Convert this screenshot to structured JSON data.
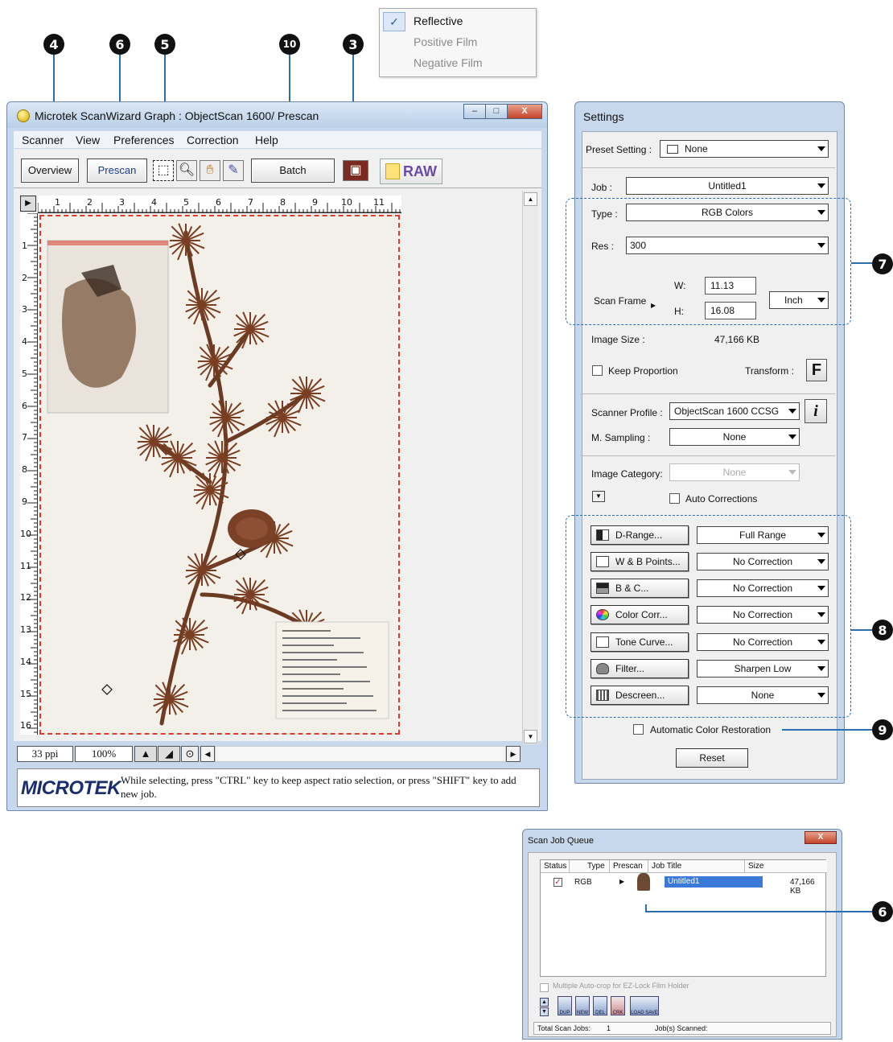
{
  "callouts": [
    "4",
    "6",
    "5",
    "10",
    "3",
    "7",
    "8",
    "9",
    "6"
  ],
  "media_menu": {
    "items": [
      {
        "label": "Reflective",
        "checked": true
      },
      {
        "label": "Positive Film",
        "checked": false
      },
      {
        "label": "Negative Film",
        "checked": false
      }
    ]
  },
  "main_window": {
    "title": "Microtek ScanWizard Graph : ObjectScan 1600/ Prescan",
    "window_buttons": {
      "minimize": "–",
      "maximize": "□",
      "close": "X"
    },
    "menus": [
      "Scanner",
      "View",
      "Preferences",
      "Correction",
      "Help"
    ],
    "toolbar": {
      "overview": "Overview",
      "prescan": "Prescan",
      "batch": "Batch",
      "raw": "RAW"
    },
    "ruler_h": [
      "1",
      "2",
      "3",
      "4",
      "5",
      "6",
      "7",
      "8",
      "9",
      "10",
      "11"
    ],
    "ruler_v": [
      "1",
      "2",
      "3",
      "4",
      "5",
      "6",
      "7",
      "8",
      "9",
      "10",
      "11",
      "12",
      "13",
      "14",
      "15",
      "16"
    ],
    "status": {
      "resolution": "33 ppi",
      "zoom": "100%"
    },
    "logo": "MICROTEK",
    "hint": "While selecting, press \"CTRL\" key to keep aspect ratio selection, or press \"SHIFT\" key to add new job."
  },
  "settings": {
    "title": "Settings",
    "preset_label": "Preset Setting :",
    "preset_value": "None",
    "job_label": "Job :",
    "job_value": "Untitled1",
    "type_label": "Type :",
    "type_value": "RGB Colors",
    "res_label": "Res :",
    "res_value": "300",
    "scan_frame_label": "Scan Frame",
    "w_label": "W:",
    "w_value": "11.13",
    "h_label": "H:",
    "h_value": "16.08",
    "unit": "Inch",
    "image_size_label": "Image Size :",
    "image_size_value": "47,166 KB",
    "keep_proportion": "Keep Proportion",
    "transform_label": "Transform :",
    "transform_icon": "F",
    "scanner_profile_label": "Scanner Profile :",
    "scanner_profile_value": "ObjectScan 1600 CCSG",
    "info_icon": "i",
    "m_sampling_label": "M. Sampling :",
    "m_sampling_value": "None",
    "image_category_label": "Image Category:",
    "image_category_value": "None",
    "auto_corrections": "Auto Corrections",
    "tools": [
      {
        "label": "D-Range...",
        "value": "Full Range"
      },
      {
        "label": "W & B Points...",
        "value": "No Correction"
      },
      {
        "label": "B & C...",
        "value": "No Correction"
      },
      {
        "label": "Color Corr...",
        "value": "No Correction"
      },
      {
        "label": "Tone Curve...",
        "value": "No Correction"
      },
      {
        "label": "Filter...",
        "value": "Sharpen Low"
      },
      {
        "label": "Descreen...",
        "value": "None"
      }
    ],
    "auto_color_restoration": "Automatic Color Restoration",
    "reset": "Reset"
  },
  "scan_job_queue": {
    "title": "Scan Job Queue",
    "close": "X",
    "columns": [
      "Status",
      "Type",
      "Prescan",
      "Job Title",
      "Size"
    ],
    "row": {
      "type": "RGB",
      "job_title": "Untitled1",
      "size": "47,166 KB"
    },
    "multi_autocrop": "Multiple Auto-crop for EZ-Lock Film Holder",
    "icons": [
      "DUP",
      "NEW",
      "DEL",
      "CRK",
      "LOAD",
      "SAVE"
    ],
    "total_label": "Total Scan Jobs:",
    "total_value": "1",
    "scanned_label": "Job(s) Scanned:"
  }
}
